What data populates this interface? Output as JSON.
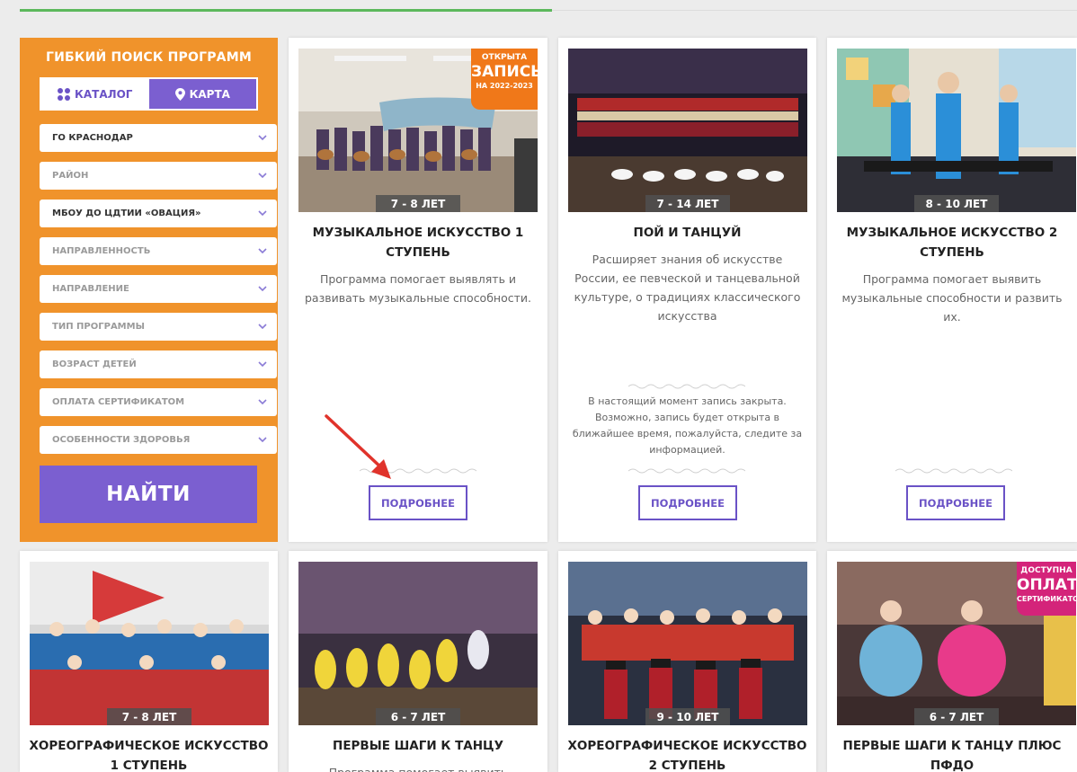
{
  "sidebar": {
    "title": "ГИБКИЙ ПОИСК ПРОГРАММ",
    "tabs": {
      "catalog": "КАТАЛОГ",
      "map": "КАРТА"
    },
    "filters": [
      "ГО КРАСНОДАР",
      "РАЙОН",
      "МБОУ ДО ЦДТИИ «ОВАЦИЯ»",
      "НАПРАВЛЕННОСТЬ",
      "НАПРАВЛЕНИЕ",
      "ТИП ПРОГРАММЫ",
      "ВОЗРАСТ ДЕТЕЙ",
      "ОПЛАТА СЕРТИФИКАТОМ",
      "ОСОБЕННОСТИ ЗДОРОВЬЯ"
    ],
    "find_label": "НАЙТИ"
  },
  "badges": {
    "open": {
      "line1": "ОТКРЫТА",
      "line2": "ЗАПИСЬ",
      "line3": "НА 2022-2023"
    },
    "pay": {
      "line1": "ДОСТУПНА",
      "line2": "ОПЛАТА",
      "line3": "СЕРТИФИКАТОМ"
    }
  },
  "more_label": "ПОДРОБНЕЕ",
  "cards": [
    {
      "age": "7 - 8 ЛЕТ",
      "title": "МУЗЫКАЛЬНОЕ ИСКУССТВО 1 СТУПЕНЬ",
      "desc": "Программа помогает выявлять и развивать музыкальные способности."
    },
    {
      "age": "7 - 14 ЛЕТ",
      "title": "ПОЙ И ТАНЦУЙ",
      "desc": "Расширяет знания об искусстве России, ее певческой и танцевальной культуре, о традициях классического искусства",
      "closed_note": "В настоящий момент запись закрыта. Возможно, запись будет открыта в ближайшее время, пожалуйста, следите за информацией."
    },
    {
      "age": "8 - 10 ЛЕТ",
      "title": "МУЗЫКАЛЬНОЕ ИСКУССТВО 2 СТУПЕНЬ",
      "desc": "Программа помогает выявить музыкальные способности и развить их."
    },
    {
      "age": "7 - 8 ЛЕТ",
      "title": "ХОРЕОГРАФИЧЕСКОЕ ИСКУССТВО 1 СТУПЕНЬ"
    },
    {
      "age": "6 - 7 ЛЕТ",
      "title": "ПЕРВЫЕ ШАГИ К ТАНЦУ",
      "desc": "Программа помогает выявить"
    },
    {
      "age": "9 - 10 ЛЕТ",
      "title": "ХОРЕОГРАФИЧЕСКОЕ ИСКУССТВО 2 СТУПЕНЬ"
    },
    {
      "age": "6 - 7 ЛЕТ",
      "title": "ПЕРВЫЕ ШАГИ К ТАНЦУ ПЛЮС ПФДО"
    }
  ],
  "colors": {
    "sidebar": "#f0932b",
    "accent": "#7b5fd0",
    "button_border": "#6a52c6",
    "badge_open": "#f07819",
    "badge_pay": "#d4247a",
    "arrow": "#e0332b",
    "top_line": "#5cb85c"
  }
}
